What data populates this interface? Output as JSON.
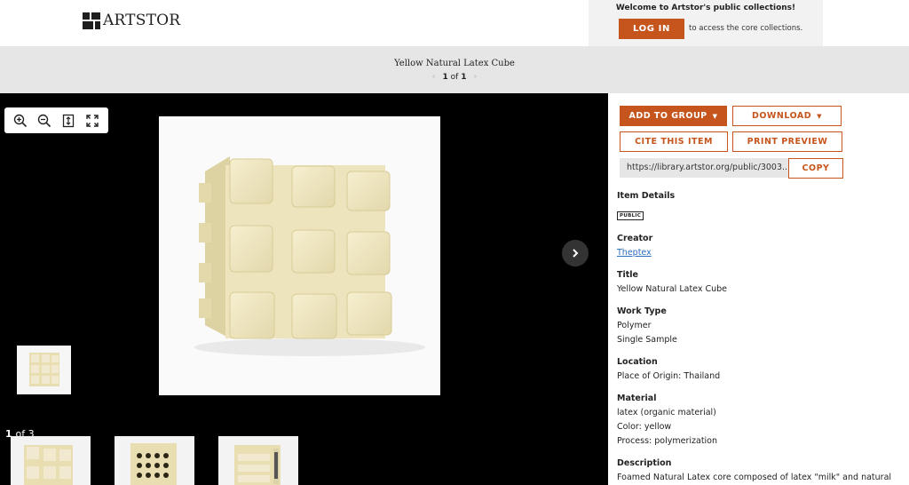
{
  "brand": {
    "logo_text": "ARTSTOR"
  },
  "login": {
    "welcome": "Welcome to Artstor's public collections!",
    "button": "LOG IN",
    "note": "to access the core collections."
  },
  "item": {
    "title": "Yellow Natural Latex Cube",
    "pager_current": "1",
    "pager_of": "of",
    "pager_total": "1"
  },
  "viewer": {
    "tools": [
      "zoom-in-icon",
      "zoom-out-icon",
      "fit-height-icon",
      "fullscreen-icon"
    ],
    "count_current": "1",
    "count_label": "of 3"
  },
  "actions": {
    "add_to_group": "ADD TO GROUP",
    "download": "DOWNLOAD",
    "cite": "CITE THIS ITEM",
    "print_preview": "PRINT PREVIEW",
    "url": "https://library.artstor.org/public/3003...",
    "copy": "COPY"
  },
  "details": {
    "heading": "Item Details",
    "badge": "PUBLIC",
    "creator_label": "Creator",
    "creator_value": "Theptex",
    "title_label": "Title",
    "title_value": "Yellow Natural Latex Cube",
    "work_type_label": "Work Type",
    "work_type_values": [
      "Polymer",
      "Single Sample"
    ],
    "location_label": "Location",
    "location_value": "Place of Origin: Thailand",
    "material_label": "Material",
    "material_values": [
      "latex (organic material)",
      "Color: yellow",
      "Process: polymerization"
    ],
    "description_label": "Description",
    "description_value": "Foamed Natural Latex core composed of latex \"milk\" and natural"
  },
  "colors": {
    "accent": "#c6551d",
    "link": "#2a6ebb",
    "titlebar": "#e6e6e6"
  }
}
